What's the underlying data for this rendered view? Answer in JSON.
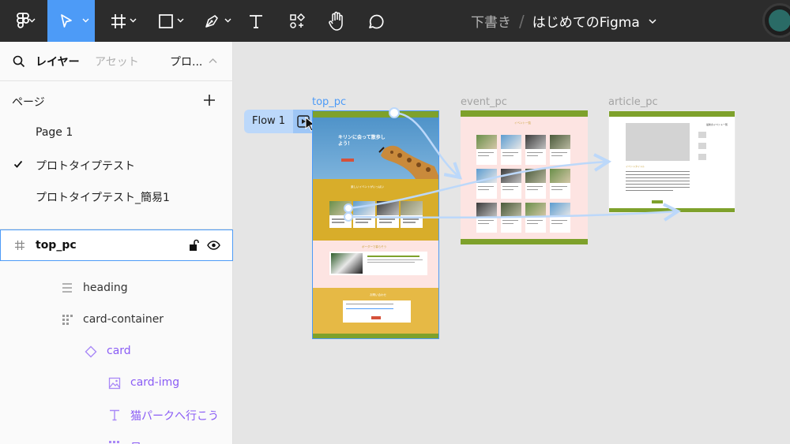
{
  "toolbar": {
    "tools": [
      "figma-menu",
      "move-tool",
      "frame-tool",
      "shape-tool",
      "pen-tool",
      "text-tool",
      "resources-tool",
      "hand-tool",
      "comment-tool"
    ],
    "breadcrumb": {
      "location": "下書き",
      "separator": "/",
      "file_name": "はじめてのFigma"
    },
    "accent_color": "#4d9bf7"
  },
  "left_panel": {
    "tabs": {
      "layers": "レイヤー",
      "assets": "アセット",
      "prototype": "プロ..."
    },
    "pages": {
      "title": "ページ",
      "items": [
        {
          "label": "Page 1",
          "selected": false
        },
        {
          "label": "プロトタイプテスト",
          "selected": true
        },
        {
          "label": "プロトタイプテスト_簡易1",
          "selected": false
        }
      ]
    },
    "layers": {
      "selected_frame": "top_pc",
      "items": [
        {
          "label": "heading",
          "icon": "text-align-icon",
          "kind": "plain"
        },
        {
          "label": "card-container",
          "icon": "grid-icon",
          "kind": "plain"
        },
        {
          "label": "card",
          "icon": "component-instance-icon",
          "kind": "component"
        },
        {
          "label": "card-img",
          "icon": "image-icon",
          "kind": "component"
        },
        {
          "label": "猫パークへ行こう",
          "icon": "text-icon",
          "kind": "component"
        },
        {
          "label": "日",
          "icon": "grid-icon",
          "kind": "component"
        }
      ]
    }
  },
  "canvas": {
    "frames": [
      {
        "label": "top_pc",
        "selected": true
      },
      {
        "label": "event_pc",
        "selected": false
      },
      {
        "label": "article_pc",
        "selected": false
      }
    ],
    "flow": {
      "label": "Flow 1"
    },
    "top_pc": {
      "hero_title": "キリンに会って散歩しよう！",
      "section1_title": "楽しいイベントがいっぱい",
      "section2_title": "ボーダーで暮らそう",
      "section3_title": "お問い合わせ"
    },
    "event_pc": {
      "title": "イベント一覧"
    },
    "article_pc": {
      "sidebar_title": "最新のイベント一覧",
      "heading": "イベントタイトル"
    }
  }
}
